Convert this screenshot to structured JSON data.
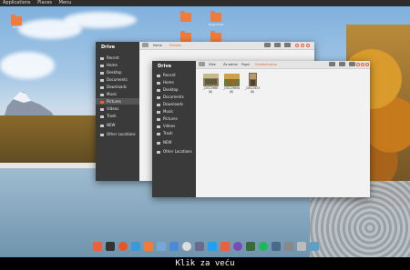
{
  "top_panel": {
    "applications_label": "Applications",
    "places_label": "Places",
    "menu_label": "Menu",
    "datetime": "",
    "status": ""
  },
  "desktop": {
    "icons": [
      {
        "label": "Home"
      },
      {
        "label": ""
      },
      {
        "label": "Downloads"
      }
    ]
  },
  "back_window": {
    "sidebar_title": "Drive",
    "sidebar_items": [
      {
        "label": "Recent"
      },
      {
        "label": "Home"
      },
      {
        "label": "Desktop"
      },
      {
        "label": "Documents"
      },
      {
        "label": "Downloads"
      },
      {
        "label": "Music"
      },
      {
        "label": "Pictures"
      },
      {
        "label": "Videos"
      },
      {
        "label": "Trash"
      },
      {
        "label": "NEW"
      },
      {
        "label": "Other Locations"
      }
    ],
    "crumbs": [
      "Home",
      "Pictures"
    ]
  },
  "front_window": {
    "sidebar_title": "Drive",
    "sidebar_items": [
      {
        "label": "Recent"
      },
      {
        "label": "Home"
      },
      {
        "label": "Desktop"
      },
      {
        "label": "Documents"
      },
      {
        "label": "Downloads"
      },
      {
        "label": "Music"
      },
      {
        "label": "Pictures"
      },
      {
        "label": "Videos"
      },
      {
        "label": "Trash"
      },
      {
        "label": "NEW"
      },
      {
        "label": "Other Locations"
      }
    ],
    "crumbs": [
      "Slike",
      "Za odmor",
      "Popni",
      "Sveobuhvatno"
    ],
    "files": [
      {
        "name": "_DSC2966",
        "sub": "(8)"
      },
      {
        "name": "_DSC2989a",
        "sub": "(8)"
      },
      {
        "name": "_DSC2923",
        "sub": "(8)"
      }
    ]
  },
  "dock": {
    "apps": [
      "files",
      "terminal",
      "ubuntu",
      "downloads",
      "folder",
      "trash",
      "chrome",
      "settings",
      "skype",
      "store",
      "firefox",
      "git",
      "spotify",
      "office",
      "files-alt",
      "tweaks"
    ]
  },
  "caption": "Klik za veću"
}
